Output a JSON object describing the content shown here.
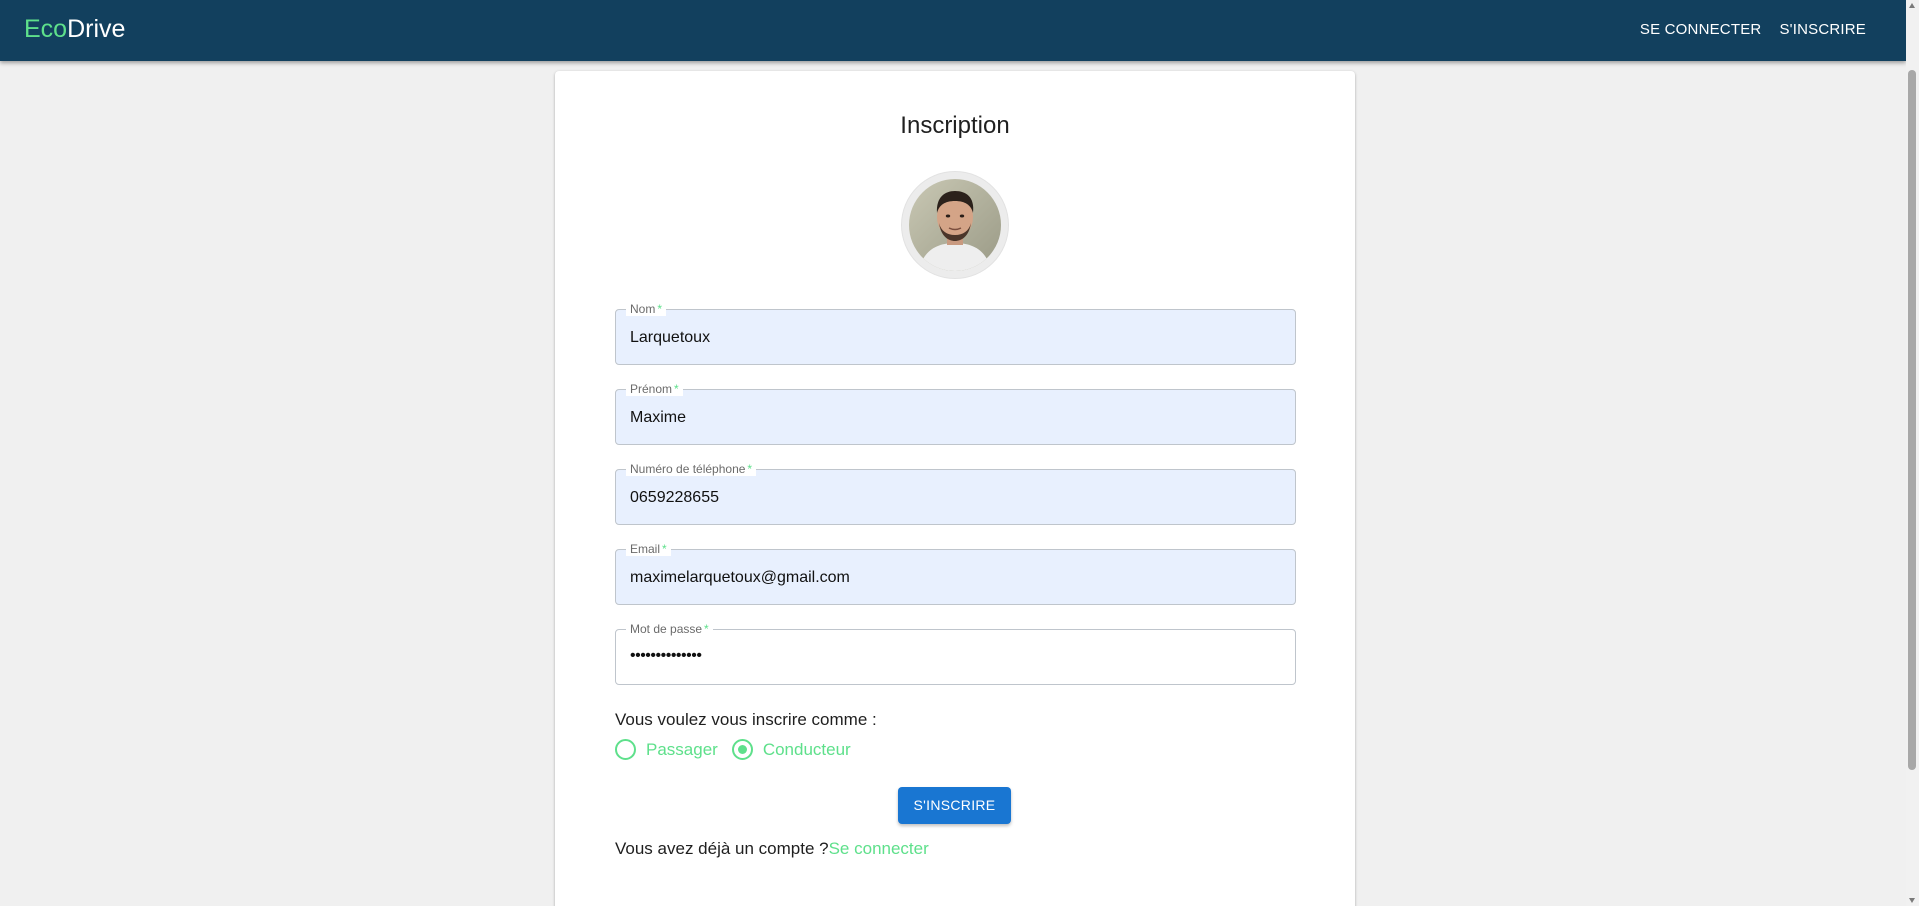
{
  "header": {
    "brand_part1": "Eco",
    "brand_part2": "Drive",
    "nav": [
      {
        "label": "SE CONNECTER"
      },
      {
        "label": "S'INSCRIRE"
      }
    ]
  },
  "form": {
    "title": "Inscription",
    "fields": [
      {
        "label": "Nom",
        "required_mark": "*",
        "value": "Larquetoux"
      },
      {
        "label": "Prénom",
        "required_mark": "*",
        "value": "Maxime"
      },
      {
        "label": "Numéro de téléphone",
        "required_mark": "*",
        "value": "0659228655"
      },
      {
        "label": "Email",
        "required_mark": "*",
        "value": "maximelarquetoux@gmail.com"
      },
      {
        "label": "Mot de passe",
        "required_mark": "*",
        "value": "••••••••••••••"
      }
    ],
    "role_question": "Vous voulez vous inscrire comme :",
    "roles": [
      {
        "label": "Passager",
        "checked": false
      },
      {
        "label": "Conducteur",
        "checked": true
      }
    ],
    "submit_label": "S'INSCRIRE",
    "login_prompt": "Vous avez déjà un compte ?",
    "login_link": "Se connecter"
  },
  "colors": {
    "appbar": "#12405e",
    "accent_green": "#5ee08b",
    "button_blue": "#1976d2",
    "autofill_bg": "#e8f0fe"
  }
}
